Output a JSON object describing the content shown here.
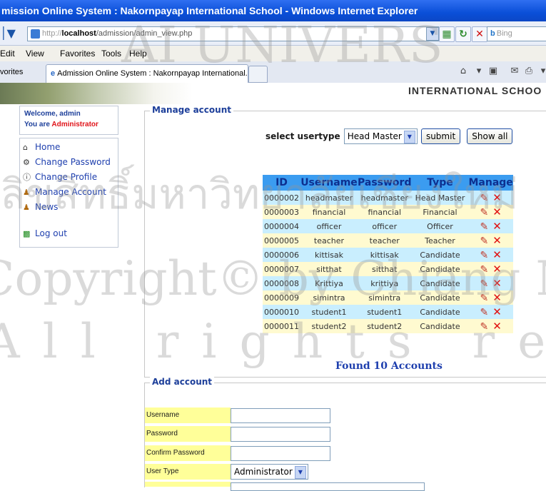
{
  "window": {
    "title": "mission Online System : Nakornpayap International School - Windows Internet Explorer"
  },
  "address": {
    "prefix": "http://",
    "host": "localhost",
    "path": "/admission/admin_view.php"
  },
  "search": {
    "placeholder": "Bing"
  },
  "menu": {
    "items": [
      "Edit",
      "View",
      "Favorites",
      "Tools",
      "Help"
    ]
  },
  "favorites_label": "vorites",
  "tab": {
    "title": "Admission Online System : Nakornpayap International..."
  },
  "banner": {
    "school": "INTERNATIONAL SCHOO"
  },
  "sidebar": {
    "welcome": "Welcome, admin",
    "role_prefix": "You are",
    "role": "Administrator",
    "items": [
      {
        "label": "Home",
        "icon": "home-icon"
      },
      {
        "label": "Change Password",
        "icon": "key-icon"
      },
      {
        "label": "Change Profile",
        "icon": "info-icon"
      },
      {
        "label": "Manage Account",
        "icon": "users-icon"
      },
      {
        "label": "News",
        "icon": "news-icon"
      }
    ],
    "logout": "Log out"
  },
  "manage": {
    "legend": "Manage account",
    "filter_label": "select usertype",
    "selected_type": "Head Master",
    "submit_label": "submit",
    "show_all_label": "Show all",
    "columns": [
      "ID",
      "Username",
      "Password",
      "Type",
      "Manage"
    ],
    "rows": [
      {
        "id": "0000002",
        "username": "headmaster",
        "password": "headmaster",
        "type": "Head Master"
      },
      {
        "id": "0000003",
        "username": "financial",
        "password": "financial",
        "type": "Financial"
      },
      {
        "id": "0000004",
        "username": "officer",
        "password": "officer",
        "type": "Officer"
      },
      {
        "id": "0000005",
        "username": "teacher",
        "password": "teacher",
        "type": "Teacher"
      },
      {
        "id": "0000006",
        "username": "kittisak",
        "password": "kittisak",
        "type": "Candidate"
      },
      {
        "id": "0000007",
        "username": "sitthat",
        "password": "sitthat",
        "type": "Candidate"
      },
      {
        "id": "0000008",
        "username": "Krittiya",
        "password": "krittiya",
        "type": "Candidate"
      },
      {
        "id": "0000009",
        "username": "simintra",
        "password": "simintra",
        "type": "Candidate"
      },
      {
        "id": "0000010",
        "username": "student1",
        "password": "student1",
        "type": "Candidate"
      },
      {
        "id": "0000011",
        "username": "student2",
        "password": "student2",
        "type": "Candidate"
      }
    ],
    "found": "Found 10 Accounts"
  },
  "add": {
    "legend": "Add account",
    "username_label": "Username",
    "password_label": "Password",
    "confirm_label": "Confirm Password",
    "usertype_label": "User Type",
    "usertype_value": "Administrator"
  },
  "watermark": {
    "line1": "AI UNIVERS",
    "line2": "ลิขสิทธิ์มหาวิทยาลัยเชียงใหม่",
    "line3": "Copyright© by Chiang Mai University",
    "line4": "All rights reserved"
  }
}
